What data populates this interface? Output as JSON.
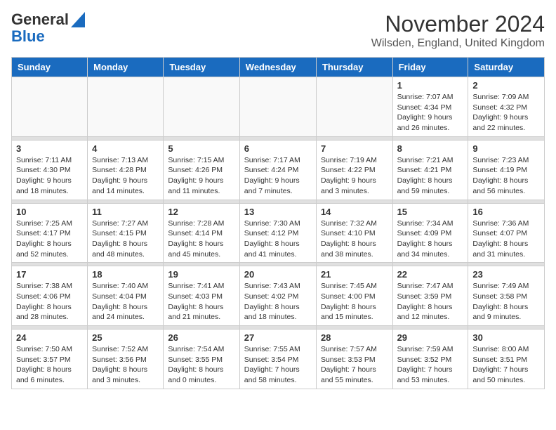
{
  "header": {
    "logo_line1": "General",
    "logo_line2": "Blue",
    "title": "November 2024",
    "subtitle": "Wilsden, England, United Kingdom"
  },
  "calendar": {
    "headers": [
      "Sunday",
      "Monday",
      "Tuesday",
      "Wednesday",
      "Thursday",
      "Friday",
      "Saturday"
    ],
    "weeks": [
      {
        "days": [
          {
            "num": "",
            "info": ""
          },
          {
            "num": "",
            "info": ""
          },
          {
            "num": "",
            "info": ""
          },
          {
            "num": "",
            "info": ""
          },
          {
            "num": "",
            "info": ""
          },
          {
            "num": "1",
            "info": "Sunrise: 7:07 AM\nSunset: 4:34 PM\nDaylight: 9 hours\nand 26 minutes."
          },
          {
            "num": "2",
            "info": "Sunrise: 7:09 AM\nSunset: 4:32 PM\nDaylight: 9 hours\nand 22 minutes."
          }
        ]
      },
      {
        "days": [
          {
            "num": "3",
            "info": "Sunrise: 7:11 AM\nSunset: 4:30 PM\nDaylight: 9 hours\nand 18 minutes."
          },
          {
            "num": "4",
            "info": "Sunrise: 7:13 AM\nSunset: 4:28 PM\nDaylight: 9 hours\nand 14 minutes."
          },
          {
            "num": "5",
            "info": "Sunrise: 7:15 AM\nSunset: 4:26 PM\nDaylight: 9 hours\nand 11 minutes."
          },
          {
            "num": "6",
            "info": "Sunrise: 7:17 AM\nSunset: 4:24 PM\nDaylight: 9 hours\nand 7 minutes."
          },
          {
            "num": "7",
            "info": "Sunrise: 7:19 AM\nSunset: 4:22 PM\nDaylight: 9 hours\nand 3 minutes."
          },
          {
            "num": "8",
            "info": "Sunrise: 7:21 AM\nSunset: 4:21 PM\nDaylight: 8 hours\nand 59 minutes."
          },
          {
            "num": "9",
            "info": "Sunrise: 7:23 AM\nSunset: 4:19 PM\nDaylight: 8 hours\nand 56 minutes."
          }
        ]
      },
      {
        "days": [
          {
            "num": "10",
            "info": "Sunrise: 7:25 AM\nSunset: 4:17 PM\nDaylight: 8 hours\nand 52 minutes."
          },
          {
            "num": "11",
            "info": "Sunrise: 7:27 AM\nSunset: 4:15 PM\nDaylight: 8 hours\nand 48 minutes."
          },
          {
            "num": "12",
            "info": "Sunrise: 7:28 AM\nSunset: 4:14 PM\nDaylight: 8 hours\nand 45 minutes."
          },
          {
            "num": "13",
            "info": "Sunrise: 7:30 AM\nSunset: 4:12 PM\nDaylight: 8 hours\nand 41 minutes."
          },
          {
            "num": "14",
            "info": "Sunrise: 7:32 AM\nSunset: 4:10 PM\nDaylight: 8 hours\nand 38 minutes."
          },
          {
            "num": "15",
            "info": "Sunrise: 7:34 AM\nSunset: 4:09 PM\nDaylight: 8 hours\nand 34 minutes."
          },
          {
            "num": "16",
            "info": "Sunrise: 7:36 AM\nSunset: 4:07 PM\nDaylight: 8 hours\nand 31 minutes."
          }
        ]
      },
      {
        "days": [
          {
            "num": "17",
            "info": "Sunrise: 7:38 AM\nSunset: 4:06 PM\nDaylight: 8 hours\nand 28 minutes."
          },
          {
            "num": "18",
            "info": "Sunrise: 7:40 AM\nSunset: 4:04 PM\nDaylight: 8 hours\nand 24 minutes."
          },
          {
            "num": "19",
            "info": "Sunrise: 7:41 AM\nSunset: 4:03 PM\nDaylight: 8 hours\nand 21 minutes."
          },
          {
            "num": "20",
            "info": "Sunrise: 7:43 AM\nSunset: 4:02 PM\nDaylight: 8 hours\nand 18 minutes."
          },
          {
            "num": "21",
            "info": "Sunrise: 7:45 AM\nSunset: 4:00 PM\nDaylight: 8 hours\nand 15 minutes."
          },
          {
            "num": "22",
            "info": "Sunrise: 7:47 AM\nSunset: 3:59 PM\nDaylight: 8 hours\nand 12 minutes."
          },
          {
            "num": "23",
            "info": "Sunrise: 7:49 AM\nSunset: 3:58 PM\nDaylight: 8 hours\nand 9 minutes."
          }
        ]
      },
      {
        "days": [
          {
            "num": "24",
            "info": "Sunrise: 7:50 AM\nSunset: 3:57 PM\nDaylight: 8 hours\nand 6 minutes."
          },
          {
            "num": "25",
            "info": "Sunrise: 7:52 AM\nSunset: 3:56 PM\nDaylight: 8 hours\nand 3 minutes."
          },
          {
            "num": "26",
            "info": "Sunrise: 7:54 AM\nSunset: 3:55 PM\nDaylight: 8 hours\nand 0 minutes."
          },
          {
            "num": "27",
            "info": "Sunrise: 7:55 AM\nSunset: 3:54 PM\nDaylight: 7 hours\nand 58 minutes."
          },
          {
            "num": "28",
            "info": "Sunrise: 7:57 AM\nSunset: 3:53 PM\nDaylight: 7 hours\nand 55 minutes."
          },
          {
            "num": "29",
            "info": "Sunrise: 7:59 AM\nSunset: 3:52 PM\nDaylight: 7 hours\nand 53 minutes."
          },
          {
            "num": "30",
            "info": "Sunrise: 8:00 AM\nSunset: 3:51 PM\nDaylight: 7 hours\nand 50 minutes."
          }
        ]
      }
    ]
  }
}
